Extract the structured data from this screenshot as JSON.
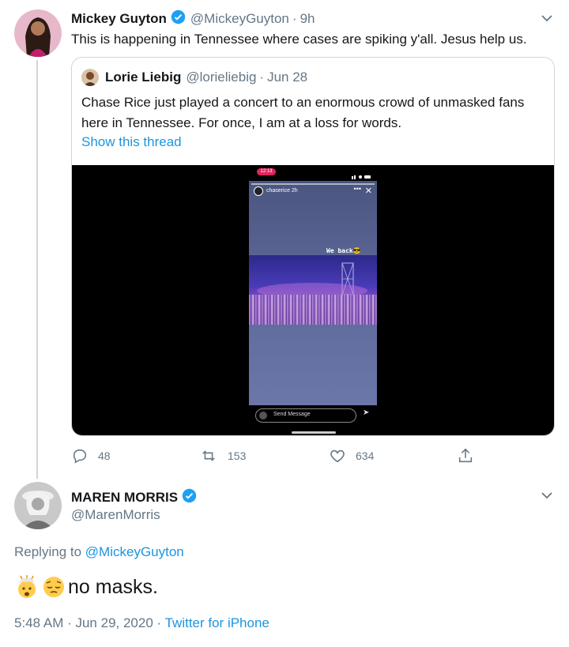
{
  "tweet1": {
    "display_name": "Mickey Guyton",
    "handle": "@MickeyGuyton",
    "separator": "·",
    "time": "9h",
    "text": "This is happening in Tennessee where cases are spiking y'all. Jesus help us."
  },
  "quote": {
    "display_name": "Lorie Liebig",
    "handle": "@lorieliebig",
    "separator": "·",
    "time": "Jun 28",
    "text": "Chase Rice just played a concert to an enormous crowd of unmasked fans here in Tennessee. For once, I am at a loss for words.",
    "show_thread": "Show this thread",
    "media": {
      "status_time": "12:13",
      "story_user": "chaserice  2h",
      "caption": "We back😎",
      "send_message": "Send Message"
    }
  },
  "actions": {
    "replies": "48",
    "retweets": "153",
    "likes": "634"
  },
  "tweet2": {
    "display_name": "MAREN MORRIS",
    "handle": "@MarenMorris",
    "replying_prefix": "Replying to",
    "replying_to": "@MickeyGuyton",
    "text": "no masks.",
    "emojis": [
      "exploding-head",
      "pensive-face"
    ],
    "timestamp": "5:48 AM · Jun 29, 2020 ·",
    "source": "Twitter for iPhone"
  },
  "colors": {
    "link": "#1b95e0",
    "muted": "#657786",
    "verified": "#1da1f2",
    "border": "#ccd6dd"
  }
}
